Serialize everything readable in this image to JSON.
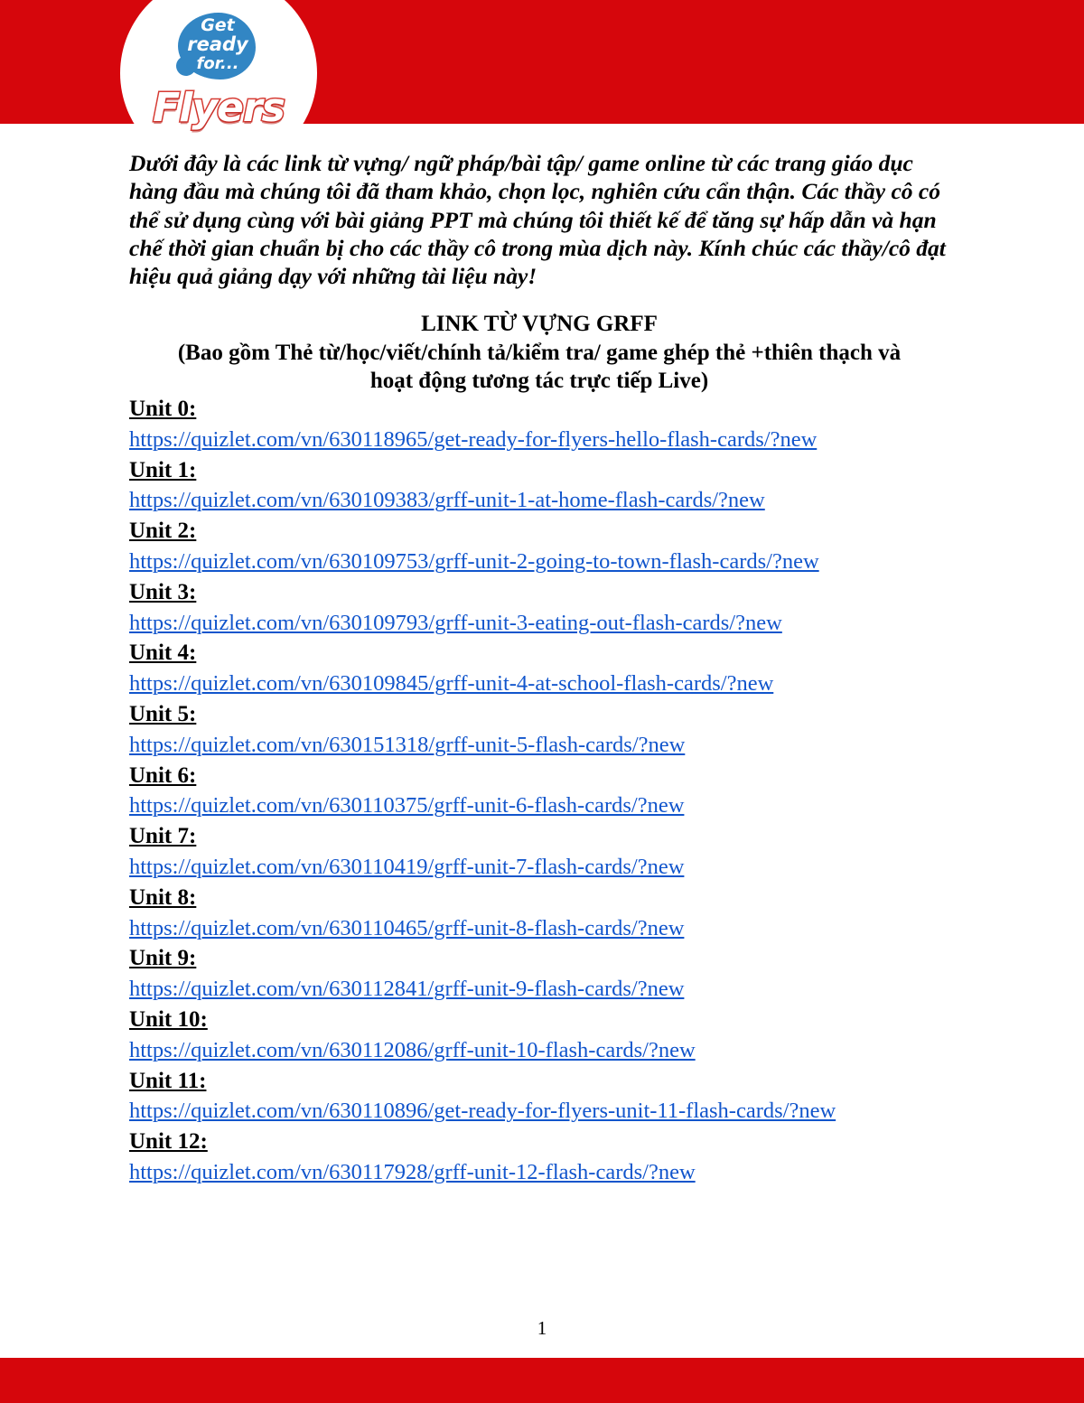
{
  "header": {
    "band_color": "#d6060c",
    "logo": {
      "bubble_line1": "Get",
      "bubble_line2": "ready",
      "bubble_line3": "for...",
      "wordmark": "Flyers",
      "bubble_color": "#3286c4",
      "wordmark_outline_color": "#d63b33"
    }
  },
  "intro": {
    "paragraph": "Dưới đây là các link từ vựng/ ngữ pháp/bài tập/ game online từ các trang giáo dục hàng đầu mà chúng tôi đã tham khảo, chọn lọc, nghiên cứu cẩn thận. Các thầy cô có thể sử dụng cùng với bài giảng PPT mà chúng tôi thiết kế để tăng sự hấp dẫn và hạn chế thời gian chuẩn bị cho các thầy cô trong mùa dịch này. Kính chúc các thầy/cô đạt hiệu quả giảng dạy với những tài liệu này!"
  },
  "section": {
    "title": "LINK TỪ VỰNG GRFF",
    "subtitle_line1": "(Bao gồm Thẻ từ/học/viết/chính tả/kiểm tra/ game ghép thẻ +thiên thạch và",
    "subtitle_line2": "hoạt động tương tác trực tiếp Live)"
  },
  "links": [
    {
      "label": "Unit 0:",
      "url": "https://quizlet.com/vn/630118965/get-ready-for-flyers-hello-flash-cards/?new"
    },
    {
      "label": "Unit 1:",
      "url": "https://quizlet.com/vn/630109383/grff-unit-1-at-home-flash-cards/?new"
    },
    {
      "label": "Unit 2:",
      "url": "https://quizlet.com/vn/630109753/grff-unit-2-going-to-town-flash-cards/?new"
    },
    {
      "label": "Unit 3:",
      "url": "https://quizlet.com/vn/630109793/grff-unit-3-eating-out-flash-cards/?new"
    },
    {
      "label": "Unit 4:",
      "url": "https://quizlet.com/vn/630109845/grff-unit-4-at-school-flash-cards/?new"
    },
    {
      "label": "Unit 5:",
      "url": "https://quizlet.com/vn/630151318/grff-unit-5-flash-cards/?new"
    },
    {
      "label": "Unit 6:",
      "url": "https://quizlet.com/vn/630110375/grff-unit-6-flash-cards/?new"
    },
    {
      "label": "Unit 7:",
      "url": "https://quizlet.com/vn/630110419/grff-unit-7-flash-cards/?new"
    },
    {
      "label": "Unit 8:",
      "url": "https://quizlet.com/vn/630110465/grff-unit-8-flash-cards/?new"
    },
    {
      "label": "Unit 9:",
      "url": "https://quizlet.com/vn/630112841/grff-unit-9-flash-cards/?new"
    },
    {
      "label": "Unit 10:",
      "url": "https://quizlet.com/vn/630112086/grff-unit-10-flash-cards/?new"
    },
    {
      "label": "Unit 11:",
      "url": "https://quizlet.com/vn/630110896/get-ready-for-flyers-unit-11-flash-cards/?new"
    },
    {
      "label": "Unit 12:",
      "url": "https://quizlet.com/vn/630117928/grff-unit-12-flash-cards/?new"
    }
  ],
  "footer": {
    "page_number": "1",
    "band_color": "#d6060c"
  }
}
